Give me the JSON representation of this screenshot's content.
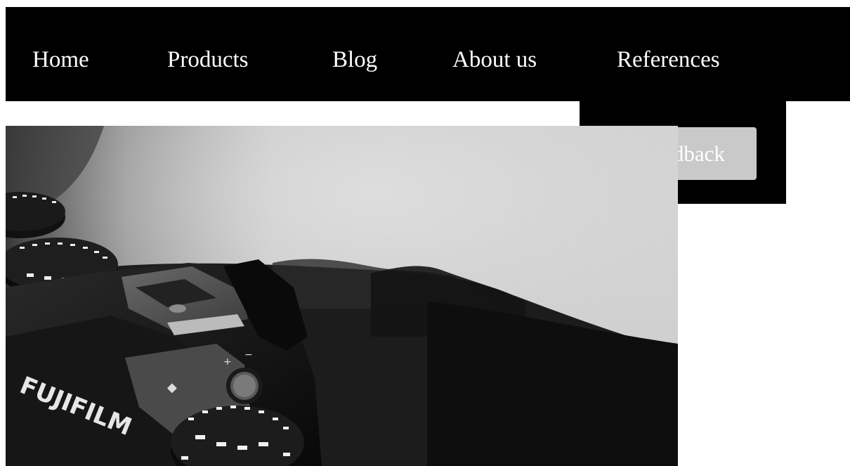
{
  "nav": {
    "items": [
      {
        "label": "Home"
      },
      {
        "label": "Products"
      },
      {
        "label": "Blog"
      },
      {
        "label": "About us"
      },
      {
        "label": "References"
      }
    ]
  },
  "dropdown": {
    "items": [
      {
        "label": "Feedback"
      }
    ]
  },
  "hero": {
    "brand_text": "FUJIFILM"
  },
  "colors": {
    "nav_bg": "#000000",
    "nav_text": "#ffffff",
    "dropdown_button_bg": "#c9c9c9",
    "page_bg": "#ffffff"
  }
}
